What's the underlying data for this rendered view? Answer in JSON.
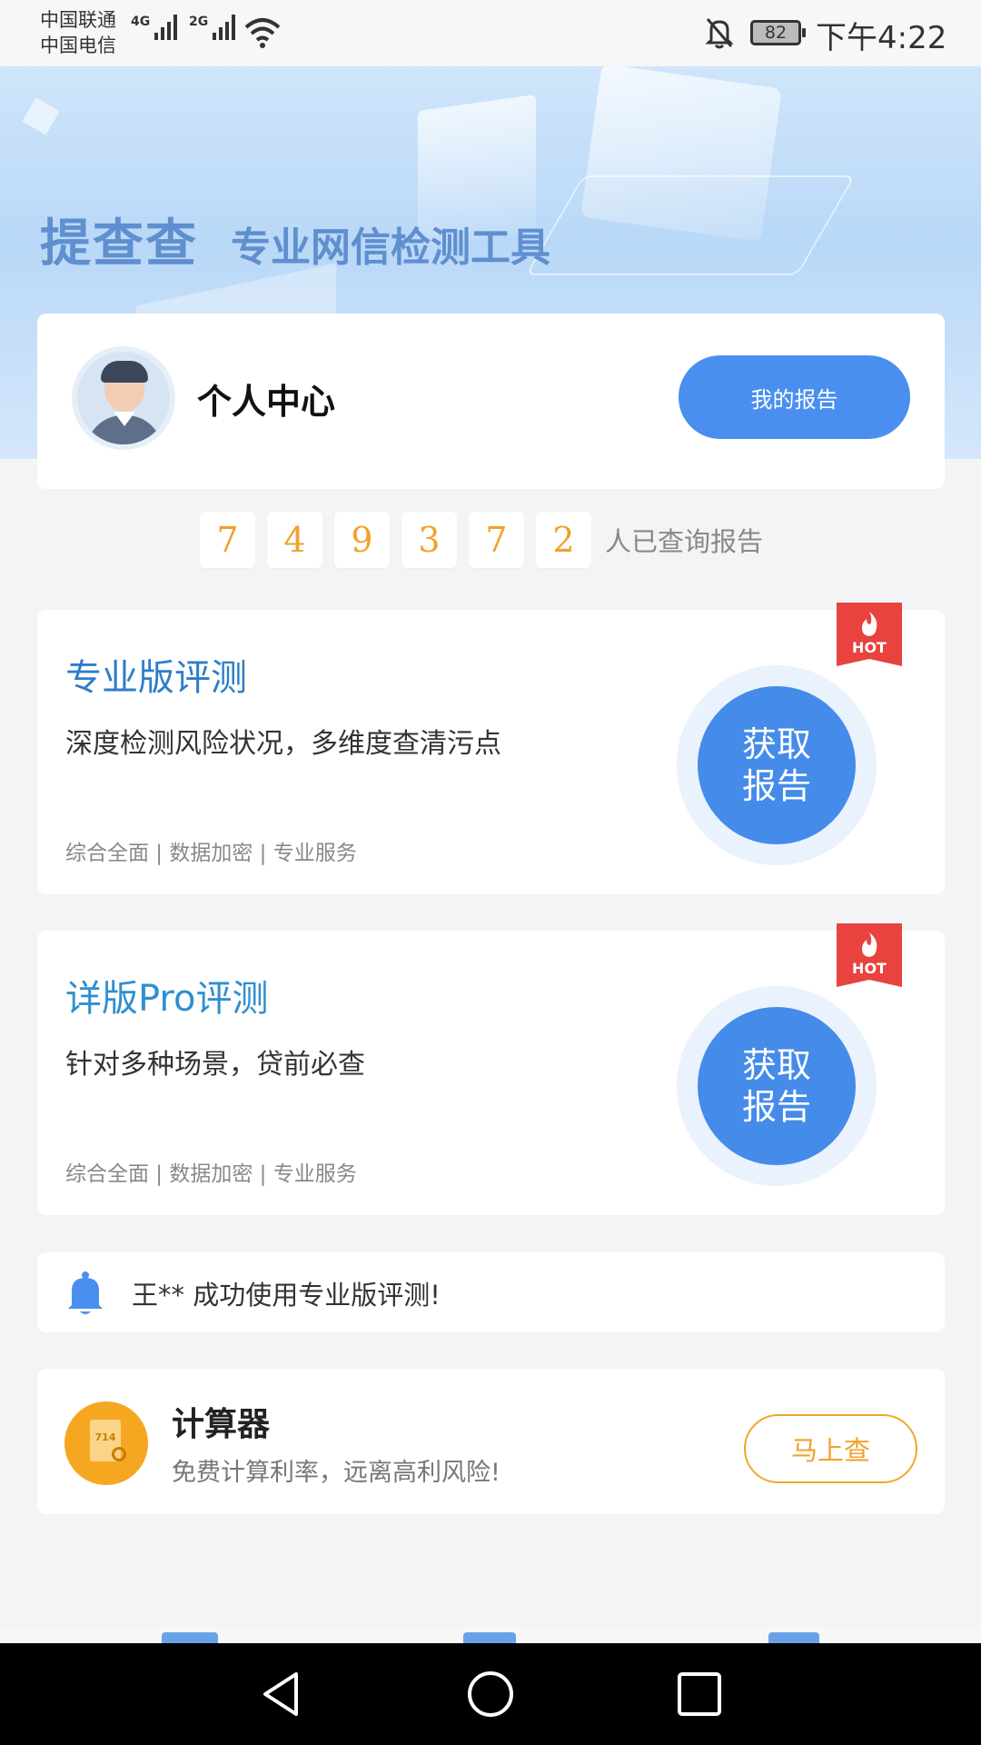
{
  "status_bar": {
    "carrier1": "中国联通",
    "carrier2": "中国电信",
    "net1": "4G",
    "net2": "2G",
    "battery": "82",
    "time": "下午4:22"
  },
  "hero": {
    "brand": "提查查",
    "tagline": "专业网信检测工具"
  },
  "profile": {
    "name": "个人中心",
    "report_button": "我的报告"
  },
  "counter": {
    "digits": [
      "7",
      "4",
      "9",
      "3",
      "7",
      "2"
    ],
    "label": "人已查询报告"
  },
  "evaluations": [
    {
      "title": "专业版评测",
      "description": "深度检测风险状况，多维度查清污点",
      "features": "综合全面 | 数据加密 | 专业服务",
      "badge": "HOT",
      "button_line1": "获取",
      "button_line2": "报告"
    },
    {
      "title": "详版Pro评测",
      "description": "针对多种场景，贷前必查",
      "features": "综合全面 | 数据加密 | 专业服务",
      "badge": "HOT",
      "button_line1": "获取",
      "button_line2": "报告"
    }
  ],
  "notice": {
    "text": "王** 成功使用专业版评测!"
  },
  "calculator": {
    "icon_text": "714",
    "title": "计算器",
    "description": "免费计算利率，远离高利风险!",
    "button": "马上查"
  },
  "colors": {
    "primary": "#4a8ff0",
    "accent_orange": "#f2a12a",
    "hot_red": "#e8433f"
  }
}
